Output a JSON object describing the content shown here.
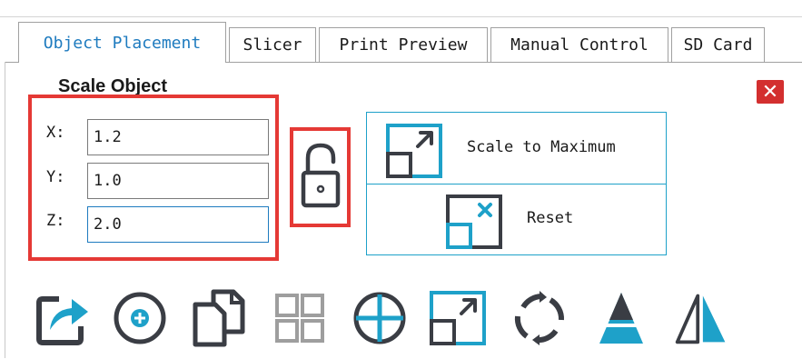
{
  "tabs": [
    {
      "label": "Object Placement",
      "active": true
    },
    {
      "label": "Slicer",
      "active": false
    },
    {
      "label": "Print Preview",
      "active": false
    },
    {
      "label": "Manual Control",
      "active": false
    },
    {
      "label": "SD Card",
      "active": false
    }
  ],
  "scale_object": {
    "title": "Scale Object",
    "close_label": "✕",
    "fields": [
      {
        "label": "X:",
        "value": "1.2"
      },
      {
        "label": "Y:",
        "value": "1.0"
      },
      {
        "label": "Z:",
        "value": "2.0"
      }
    ],
    "lock_state": "unlocked",
    "buttons": {
      "scale_max": "Scale to Maximum",
      "reset": "Reset"
    }
  },
  "toolbar": {
    "icons": [
      "export-icon",
      "add-object-icon",
      "copy-objects-icon",
      "auto-arrange-icon",
      "center-object-icon",
      "scale-object-icon",
      "rotate-object-icon",
      "cut-object-icon",
      "mirror-object-icon"
    ]
  },
  "colors": {
    "accent": "#1ea1c9",
    "icon_dark": "#3a3d44",
    "icon_disabled": "#9e9e9e",
    "highlight_red": "#e53935",
    "close_red": "#d32f2f",
    "active_tab_text": "#1e7bbf"
  }
}
